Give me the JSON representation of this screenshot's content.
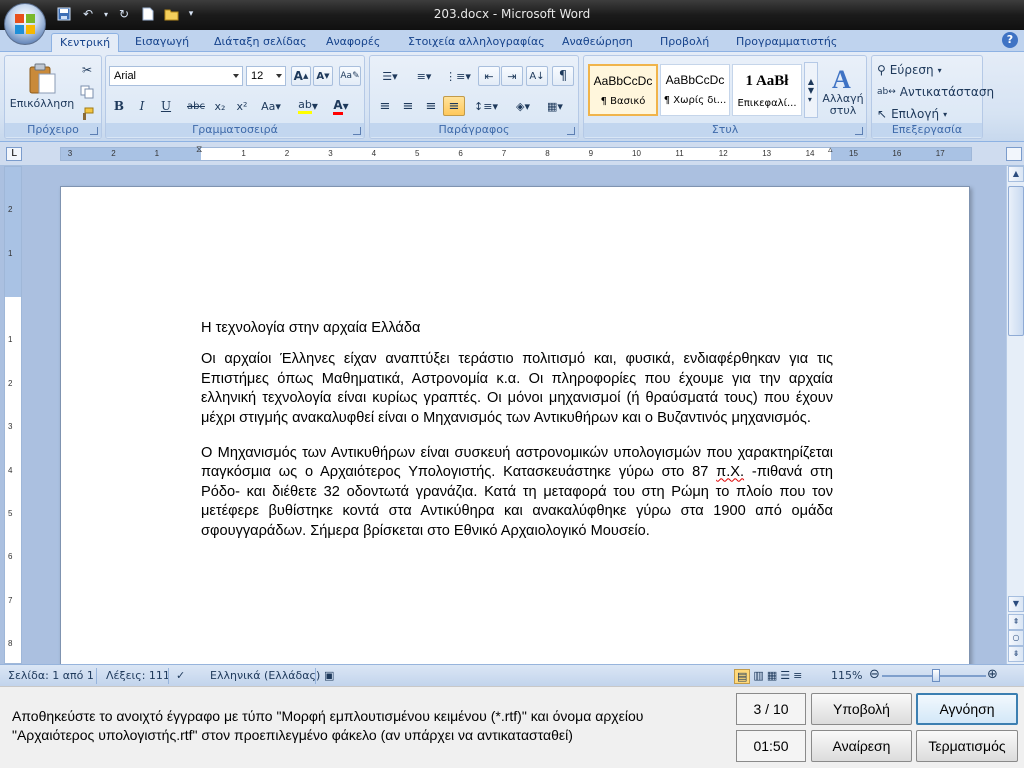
{
  "window": {
    "title": "203.docx - Microsoft Word"
  },
  "tabs": [
    "Κεντρική",
    "Εισαγωγή",
    "Διάταξη σελίδας",
    "Αναφορές",
    "Στοιχεία αλληλογραφίας",
    "Αναθεώρηση",
    "Προβολή",
    "Προγραμματιστής"
  ],
  "ribbon": {
    "clipboard": {
      "paste_label": "Επικόλληση",
      "group_label": "Πρόχειρο"
    },
    "font": {
      "font_name": "Arial",
      "font_size": "12",
      "group_label": "Γραμματοσειρά"
    },
    "paragraph": {
      "group_label": "Παράγραφος"
    },
    "styles": {
      "group_label": "Στυλ",
      "items": [
        {
          "sample": "AaBbCcDc",
          "name": "¶ Βασικό"
        },
        {
          "sample": "AaBbCcDc",
          "name": "¶ Χωρίς δι..."
        },
        {
          "sample": "1 AaBł",
          "name": "Επικεφαλί..."
        }
      ],
      "change_styles_label1": "Αλλαγή",
      "change_styles_label2": "στυλ"
    },
    "editing": {
      "group_label": "Επεξεργασία",
      "find": "Εύρεση",
      "replace": "Αντικατάσταση",
      "select": "Επιλογή"
    }
  },
  "document": {
    "title": "Η τεχνολογία στην αρχαία Ελλάδα",
    "para1": "Οι αρχαίοι Έλληνες είχαν αναπτύξει τεράστιο πολιτισμό και, φυσικά, ενδιαφέρθηκαν για τις Επιστήμες όπως Μαθηματικά, Αστρονομία κ.α. Οι πληροφορίες που έχουμε για την αρχαία ελληνική τεχνολογία είναι κυρίως γραπτές. Οι μόνοι μηχανισμοί (ή θραύσματά τους) που έχουν μέχρι στιγμής ανακαλυφθεί είναι ο Μηχανισμός των Αντικυθήρων και ο Βυζαντινός μηχανισμός.",
    "para2_before": "Ο Μηχανισμός των Αντικυθήρων είναι συσκευή αστρονομικών υπολογισμών που χαρακτηρίζεται παγκόσμια ως ο Αρχαιότερος Υπολογιστής. Κατασκευάστηκε γύρω στο 87 ",
    "para2_flagged": "π.Χ.",
    "para2_after": " -πιθανά στη Ρόδο- και διέθετε 32 οδοντωτά γρανάζια. Κατά τη μεταφορά του στη Ρώμη το πλοίο που τον μετέφερε βυθίστηκε κοντά στα Αντικύθηρα και ανακαλύφθηκε γύρω στα 1900 από ομάδα σφουγγαράδων. Σήμερα βρίσκεται στο Εθνικό Αρχαιολογικό Μουσείο."
  },
  "ruler_numbers": [
    "3",
    "2",
    "1",
    "1",
    "2",
    "3",
    "4",
    "5",
    "6",
    "7",
    "8",
    "9",
    "10",
    "11",
    "12",
    "13",
    "14",
    "15",
    "16",
    "17"
  ],
  "vruler_numbers": [
    "2",
    "1",
    "1",
    "2",
    "3",
    "4",
    "5",
    "6",
    "7",
    "8"
  ],
  "statusbar": {
    "page": "Σελίδα: 1 από 1",
    "words": "Λέξεις: 111",
    "language": "Ελληνικά (Ελλάδας)",
    "zoom": "115%"
  },
  "task": {
    "instruction": "Αποθηκεύστε το ανοιχτό έγγραφο με τύπο \"Μορφή εμπλουτισμένου κειμένου (*.rtf)\" και όνομα αρχείου \"Αρχαιότερος υπολογιστής.rtf\" στον προεπιλεγμένο φάκελο (αν υπάρχει να αντικατασταθεί)",
    "progress": "3 / 10",
    "timer": "01:50",
    "submit": "Υποβολή",
    "ignore": "Αγνόηση",
    "undo": "Αναίρεση",
    "finish": "Τερματισμός"
  }
}
